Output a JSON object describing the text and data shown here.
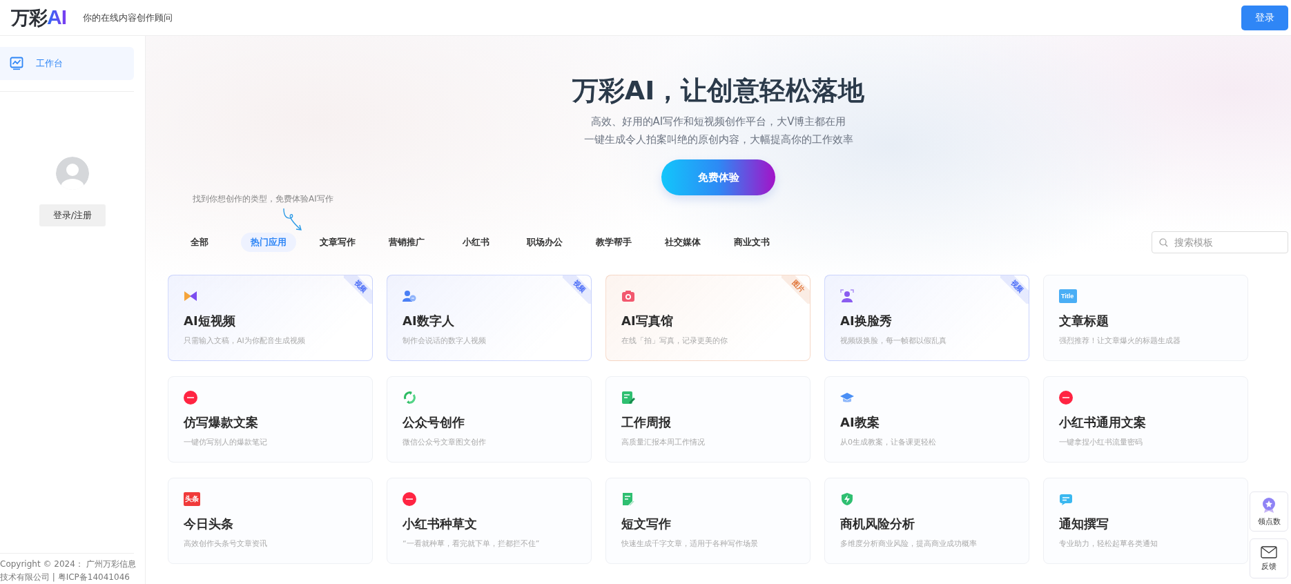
{
  "header": {
    "logo": {
      "text": "万彩",
      "mark": "AI"
    },
    "tagline": "你的在线内容创作顾问",
    "login_button": "登录"
  },
  "sidebar": {
    "items": [
      {
        "label": "工作台",
        "selected": true
      }
    ],
    "login_register": "登录/注册",
    "footer": "Copyright © 2024： 广州万彩信息技术有限公司 | 粤ICP备14041046"
  },
  "hero": {
    "title": "万彩AI，让创意轻松落地",
    "subtitle_lines": [
      "高效、好用的AI写作和短视频创作平台，大V博主都在用",
      "一键生成令人拍案叫绝的原创内容，大幅提高你的工作效率"
    ],
    "cta": "免费体验",
    "hint": "找到你想创作的类型，免费体验AI写作"
  },
  "tabs": [
    {
      "label": "全部",
      "selected": false
    },
    {
      "label": "热门应用",
      "selected": true
    },
    {
      "label": "文章写作",
      "selected": false
    },
    {
      "label": "营销推广",
      "selected": false
    },
    {
      "label": "小红书",
      "selected": false
    },
    {
      "label": "职场办公",
      "selected": false
    },
    {
      "label": "教学帮手",
      "selected": false
    },
    {
      "label": "社交媒体",
      "selected": false
    },
    {
      "label": "商业文书",
      "selected": false
    }
  ],
  "search": {
    "placeholder": "搜索模板"
  },
  "cards": [
    {
      "kind": "play",
      "title": "AI短视频",
      "description": "只需输入文稿，AI为你配音生成视频",
      "badge": {
        "text": "视频",
        "color": "#4a6cf7"
      }
    },
    {
      "kind": "person",
      "title": "AI数字人",
      "description": "制作会说话的数字人视频",
      "badge": {
        "text": "视频",
        "color": "#4a6cf7"
      }
    },
    {
      "kind": "camera",
      "title": "AI写真馆",
      "description": "在线「拍」写真，记录更美的你",
      "badge": {
        "text": "图片",
        "color": "#e0763a"
      }
    },
    {
      "kind": "face",
      "title": "AI换脸秀",
      "description": "视频级换脸，每一帧都以假乱真",
      "badge": {
        "text": "视频",
        "color": "#4a6cf7"
      }
    },
    {
      "kind": "title",
      "icon_text": "Title",
      "title": "文章标题",
      "description": "强烈推荐！让文章爆火的标题生成器"
    },
    {
      "kind": "xhs",
      "title": "仿写爆款文案",
      "description": "一键仿写别人的爆款笔记"
    },
    {
      "kind": "wechat",
      "title": "公众号创作",
      "description": "微信公众号文章图文创作"
    },
    {
      "kind": "report",
      "title": "工作周报",
      "description": "高质量汇报本周工作情况"
    },
    {
      "kind": "cap",
      "title": "AI教案",
      "description": "从0生成教案，让备课更轻松"
    },
    {
      "kind": "xhs",
      "title": "小红书通用文案",
      "description": "一键拿捏小红书流量密码"
    },
    {
      "kind": "toutiao",
      "icon_text": "头条",
      "title": "今日头条",
      "description": "高效创作头条号文章资讯"
    },
    {
      "kind": "xhs",
      "title": "小红书种草文",
      "description": "“一看就种草，看完就下单，拦都拦不住”"
    },
    {
      "kind": "note",
      "title": "短文写作",
      "description": "快速生成千字文章，适用于各种写作场景"
    },
    {
      "kind": "shield",
      "title": "商机风险分析",
      "description": "多维度分析商业风险，提高商业成功概率"
    },
    {
      "kind": "chat",
      "title": "通知撰写",
      "description": "专业助力，轻松起草各类通知"
    }
  ],
  "float_buttons": [
    {
      "kind": "points",
      "label": "领点数"
    },
    {
      "kind": "feedback",
      "label": "反馈"
    }
  ]
}
